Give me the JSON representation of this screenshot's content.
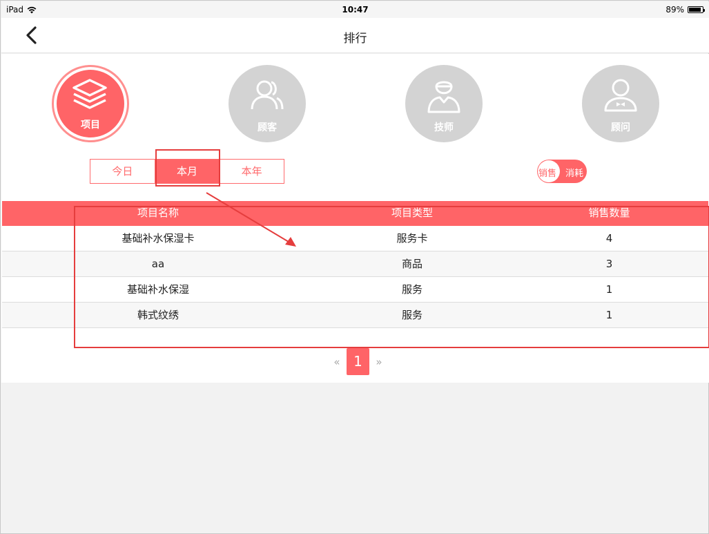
{
  "statusbar": {
    "device": "iPad",
    "time": "10:47",
    "battery": "89%",
    "battery_level": 0.89
  },
  "navbar": {
    "title": "排行"
  },
  "categories": [
    {
      "label": "项目",
      "icon": "layers-icon",
      "active": true
    },
    {
      "label": "顾客",
      "icon": "users-icon",
      "active": false
    },
    {
      "label": "技师",
      "icon": "technician-icon",
      "active": false
    },
    {
      "label": "顾问",
      "icon": "consultant-icon",
      "active": false
    }
  ],
  "period_tabs": [
    {
      "label": "今日",
      "active": false
    },
    {
      "label": "本月",
      "active": true
    },
    {
      "label": "本年",
      "active": false
    }
  ],
  "mode_toggle": {
    "left_label": "销售",
    "right_label": "消耗"
  },
  "table": {
    "headers": [
      "项目名称",
      "项目类型",
      "销售数量"
    ],
    "rows": [
      [
        "基础补水保湿卡",
        "服务卡",
        "4"
      ],
      [
        "aa",
        "商品",
        "3"
      ],
      [
        "基础补水保湿",
        "服务",
        "1"
      ],
      [
        "韩式纹绣",
        "服务",
        "1"
      ]
    ]
  },
  "pagination": {
    "prev": "«",
    "current": "1",
    "next": "»"
  },
  "colors": {
    "accent": "#ff6467",
    "inactive_icon": "#d3d3d3",
    "annotation": "#e53d3d"
  }
}
